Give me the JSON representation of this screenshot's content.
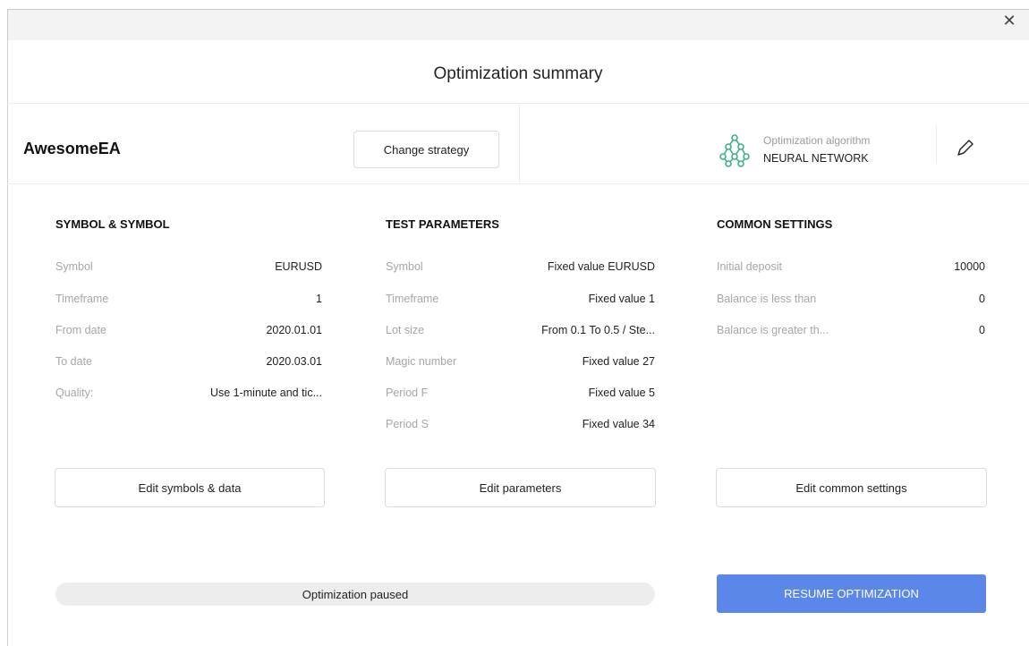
{
  "window": {
    "close_glyph": "✕"
  },
  "title": "Optimization summary",
  "strategy": {
    "name": "AwesomeEA",
    "change_label": "Change strategy"
  },
  "algorithm": {
    "label": "Optimization algorithm",
    "value": "NEURAL NETWORK",
    "icon": "neural-network-icon",
    "accent": "#3fb08a"
  },
  "columns": [
    {
      "heading": "SYMBOL & SYMBOL",
      "rows": [
        {
          "key": "Symbol",
          "value": "EURUSD"
        },
        {
          "key": "Timeframe",
          "value": "1"
        },
        {
          "key": "From date",
          "value": "2020.01.01"
        },
        {
          "key": "To date",
          "value": "2020.03.01"
        },
        {
          "key": "Quality:",
          "value": "Use 1-minute and tic..."
        }
      ],
      "button": "Edit symbols & data"
    },
    {
      "heading": "TEST PARAMETERS",
      "rows": [
        {
          "key": "Symbol",
          "value": "Fixed value EURUSD"
        },
        {
          "key": "Timeframe",
          "value": "Fixed value 1"
        },
        {
          "key": "Lot size",
          "value": "From 0.1 To 0.5 / Ste..."
        },
        {
          "key": "Magic number",
          "value": "Fixed value 27"
        },
        {
          "key": "Period F",
          "value": "Fixed value 5"
        },
        {
          "key": "Period S",
          "value": "Fixed value 34"
        }
      ],
      "button": "Edit parameters"
    },
    {
      "heading": "COMMON SETTINGS",
      "rows": [
        {
          "key": "Initial deposit",
          "value": "10000"
        },
        {
          "key": "Balance is less than",
          "value": "0"
        },
        {
          "key": "Balance is greater th...",
          "value": "0"
        }
      ],
      "button": "Edit common settings"
    }
  ],
  "status": {
    "text": "Optimization paused"
  },
  "resume_label": "RESUME OPTIMIZATION",
  "colors": {
    "primary": "#5b86ea",
    "muted_text": "#a6a6a6"
  }
}
